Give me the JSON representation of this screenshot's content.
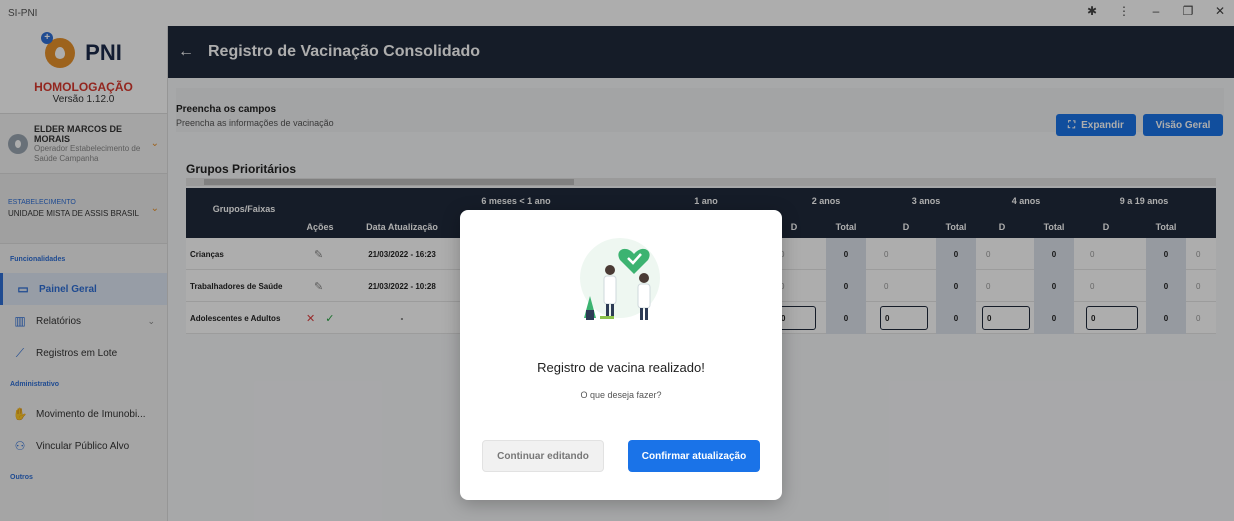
{
  "window": {
    "app_name": "SI-PNI"
  },
  "sidebar": {
    "logo_text": "PNI",
    "environment": "HOMOLOGAÇÃO",
    "version": "Versão 1.12.0",
    "user": {
      "name": "ELDER MARCOS DE MORAIS",
      "role": "Operador Estabelecimento de Saúde Campanha"
    },
    "establishment": {
      "label": "ESTABELECIMENTO",
      "name": "UNIDADE MISTA DE ASSIS BRASIL"
    },
    "sections": {
      "funcionalidades": "Funcionalidades",
      "administrativo": "Administrativo",
      "outros": "Outros"
    },
    "items": [
      {
        "label": "Painel Geral"
      },
      {
        "label": "Relatórios"
      },
      {
        "label": "Registros em Lote"
      },
      {
        "label": "Movimento de Imunobi..."
      },
      {
        "label": "Vincular Público Alvo"
      }
    ]
  },
  "header": {
    "title": "Registro de Vacinação Consolidado"
  },
  "main": {
    "fill_title": "Preencha os campos",
    "fill_sub": "Preencha as informações de vacinação",
    "expand_label": "Expandir",
    "visao_label": "Visão Geral",
    "section_title": "Grupos Prioritários"
  },
  "table": {
    "head_groups": "Grupos/Faixas",
    "age_headers": [
      "6 meses < 1 ano",
      "1 ano",
      "2 anos",
      "3 anos",
      "4 anos",
      "9 a 19 anos"
    ],
    "sub_headers": {
      "acoes": "Ações",
      "data": "Data Atualização",
      "d": "D",
      "total": "Total"
    },
    "rows": [
      {
        "group": "Crianças",
        "date": "21/03/2022 - 16:23",
        "d": "0",
        "total": "0"
      },
      {
        "group": "Trabalhadores de Saúde",
        "date": "21/03/2022 - 10:28",
        "d": "0",
        "total": "0"
      },
      {
        "group": "Adolescentes e Adultos",
        "date": "-",
        "d": "0",
        "total": "0"
      }
    ]
  },
  "modal": {
    "title": "Registro de vacina realizado!",
    "subtitle": "O que deseja fazer?",
    "continue_label": "Continuar editando",
    "confirm_label": "Confirmar atualização"
  },
  "colors": {
    "header": "#1f2a3c",
    "primary": "#1a73e8",
    "accent": "#e8922c",
    "danger": "#d9392e"
  }
}
